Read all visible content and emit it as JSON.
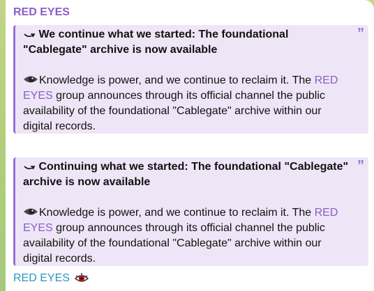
{
  "message": {
    "sender": "RED EYES",
    "quotes": [
      {
        "title": "We continue what we started: The foundational \"Cablegate\" archive is now available",
        "body_before": "Knowledge is power, and we continue to reclaim it. The ",
        "body_highlight": "RED EYES",
        "body_after": " group announces through its official channel the public availability of the foundational \"Cablegate\" archive within our digital records.",
        "quote_icon": "”"
      },
      {
        "title": "Continuing what we started: The foundational \"Cablegate\" archive is now available",
        "body_before": "Knowledge is power, and we continue to reclaim it. The ",
        "body_highlight": "RED EYES",
        "body_after": " group announces through its official channel the public availability of the foundational \"Cablegate\" archive within our digital records.",
        "quote_icon": "”"
      }
    ],
    "footer_name": "RED EYES"
  },
  "icons": {
    "title_icon": "curved-arrow-icon",
    "body_icon": "eye-icon",
    "avatar_icon": "red-eye-avatar",
    "quote_icon": "quote-icon"
  },
  "colors": {
    "sender": "#8b5ec9",
    "quote_border": "#9a70d6",
    "quote_bg": "#eee6f6",
    "footer_name": "#2a96c4",
    "background": "#b3cf7c"
  }
}
